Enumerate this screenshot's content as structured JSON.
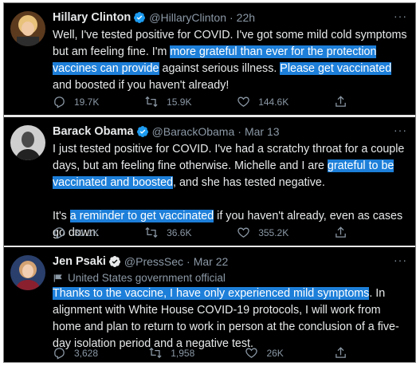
{
  "tweets": [
    {
      "name": "Hillary Clinton",
      "handle": "@HillaryClinton",
      "time": "22h",
      "label": "",
      "text_parts": [
        "Well, I've tested positive for COVID. I've got some mild cold symptoms but am feeling fine. I'm ",
        "more grateful than ever for the protection vaccines can provide",
        " against serious illness. ",
        "Please get vaccinated",
        " and boosted if you haven't already!"
      ],
      "replies": "19.7K",
      "retweets": "15.9K",
      "likes": "144.6K"
    },
    {
      "name": "Barack Obama",
      "handle": "@BarackObama",
      "time": "Mar 13",
      "label": "",
      "text_parts": [
        "I just tested positive for COVID. I've had a scratchy throat for a couple days, but am feeling fine otherwise. Michelle and I are ",
        "grateful to be vaccinated and boosted",
        ", and she has tested negative."
      ],
      "text2_parts": [
        "It's ",
        "a reminder to get vaccinated",
        " if you haven't already, even as cases go down."
      ],
      "replies": "31.1K",
      "retweets": "36.6K",
      "likes": "355.2K"
    },
    {
      "name": "Jen Psaki",
      "handle": "@PressSec",
      "time": "Mar 22",
      "label": "United States government official",
      "text_parts": [
        "Thanks to the vaccine, I have only experienced mild symptoms",
        ". In alignment with White House COVID-19 protocols, I will work from home and plan to return to work in person at the conclusion of a five-day isolation period and a negative test."
      ],
      "replies": "3,628",
      "retweets": "1,958",
      "likes": "26K"
    }
  ],
  "ui": {
    "more": "···",
    "separator": "·"
  },
  "icons": [
    "verified-badge-icon",
    "reply-icon",
    "retweet-icon",
    "like-icon",
    "share-icon",
    "government-label-icon"
  ],
  "colors": {
    "background": "#000000",
    "text": "#e7e9ea",
    "muted": "#8b98a5",
    "highlight": "#1d7fd9",
    "verified": "#1d9bf0"
  }
}
